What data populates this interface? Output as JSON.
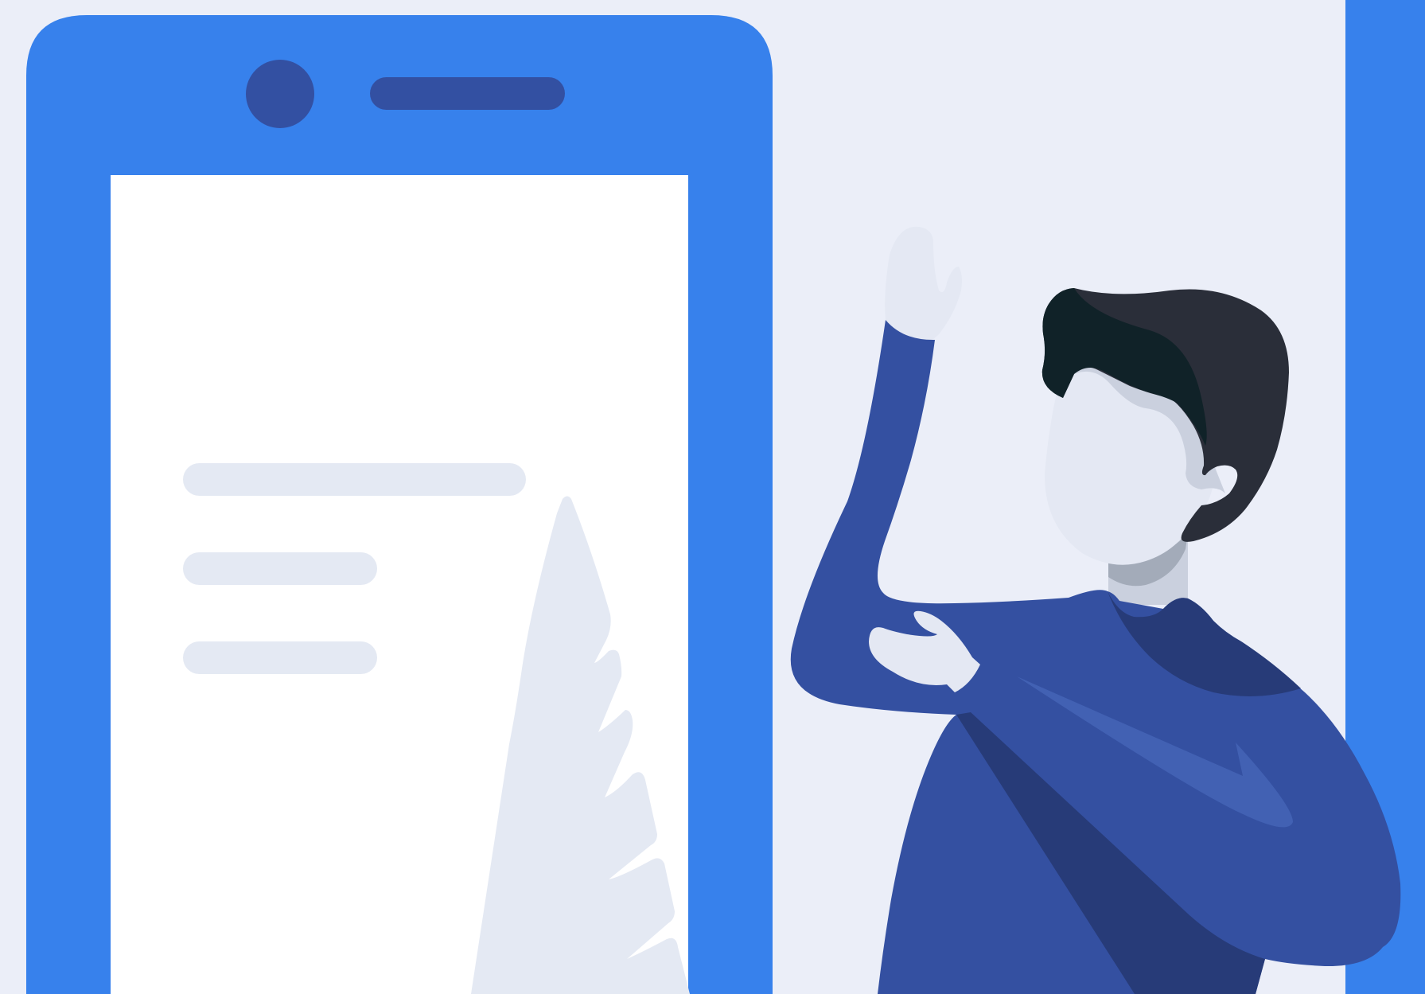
{
  "scene": {
    "description_free": true,
    "colors": {
      "background": "#EBEEF8",
      "accent_blue": "#3781EC",
      "phone_dark": "#3350A2",
      "screen": "#FFFFFF",
      "placeholder_line": "#E4E9F3",
      "shirt": "#3450A1",
      "shirt_shadow": "#273B78",
      "shirt_highlight": "#4261B3",
      "skin": "#E4E8F3",
      "skin_shadow": "#CAD0DE",
      "neck_shadow": "#A3ABB9",
      "hair_dark": "#102228",
      "hair": "#2A2E39"
    },
    "icons": [
      "phone-illustration",
      "phone-camera-icon",
      "phone-speaker-icon",
      "plant-leaf-icon",
      "waving-person-illustration"
    ]
  }
}
